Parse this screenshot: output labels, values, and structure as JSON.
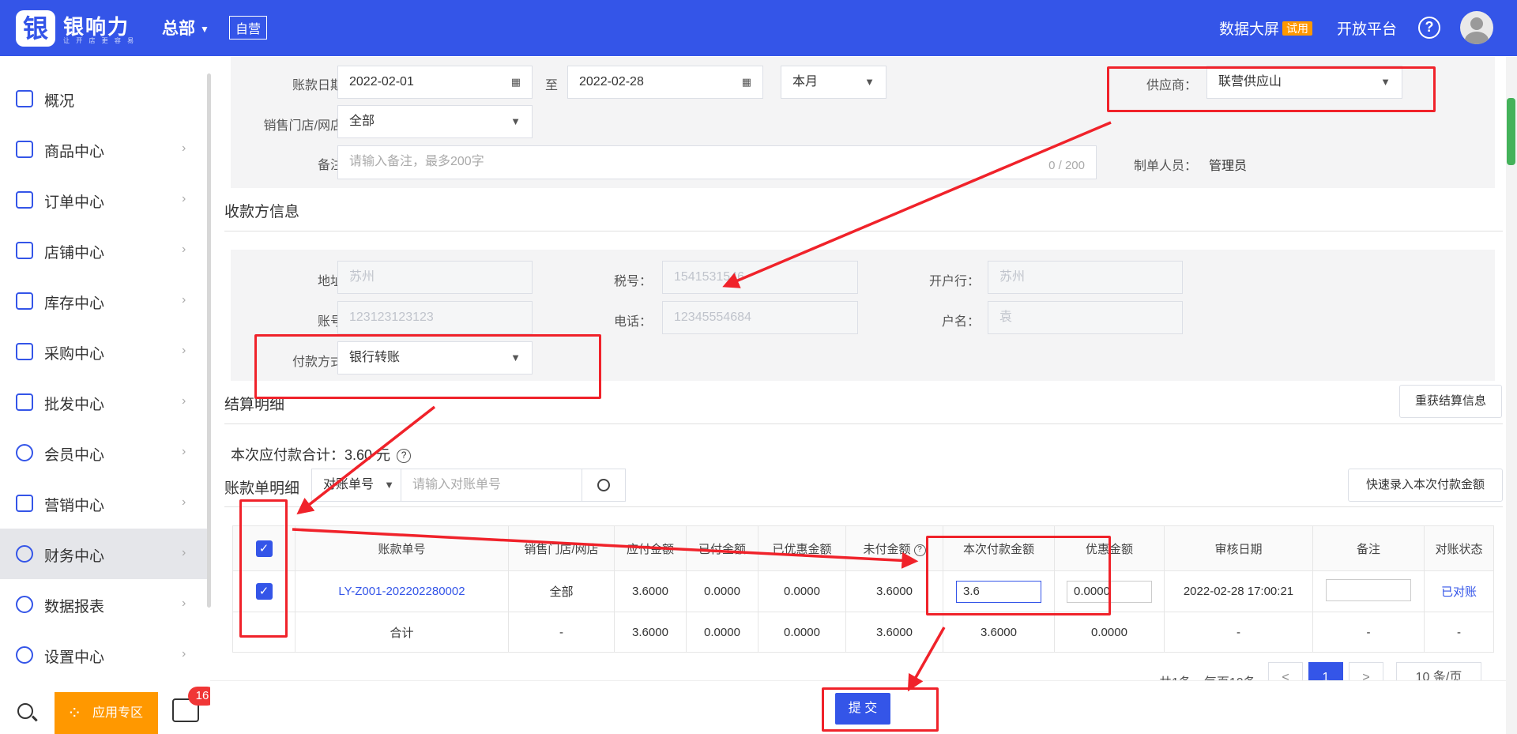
{
  "header": {
    "brand": "银响力",
    "brand_sub": "让 开 店 更 容 易",
    "hq": "总部",
    "self_tag": "自营",
    "data_screen": "数据大屏",
    "trial": "试用",
    "open_platform": "开放平台",
    "help": "?"
  },
  "sidebar": {
    "items": [
      {
        "label": "概况"
      },
      {
        "label": "商品中心"
      },
      {
        "label": "订单中心"
      },
      {
        "label": "店铺中心"
      },
      {
        "label": "库存中心"
      },
      {
        "label": "采购中心"
      },
      {
        "label": "批发中心"
      },
      {
        "label": "会员中心"
      },
      {
        "label": "营销中心"
      },
      {
        "label": "财务中心"
      },
      {
        "label": "数据报表"
      },
      {
        "label": "设置中心"
      }
    ],
    "app_zone": "应用专区",
    "msg_count": "16"
  },
  "form": {
    "date_label": "账款日期：",
    "date_start": "2022-02-01",
    "to": "至",
    "date_end": "2022-02-28",
    "period": "本月",
    "supplier_label": "供应商：",
    "supplier": "联营供应山",
    "store_label": "销售门店/网店：",
    "store": "全部",
    "remark_label": "备注：",
    "remark_placeholder": "请输入备注，最多200字",
    "remark_count": "0 / 200",
    "creator_label": "制单人员：",
    "creator": "管理员"
  },
  "payee": {
    "title": "收款方信息",
    "address_label": "地址：",
    "address": "苏州",
    "tax_label": "税号：",
    "tax": "1541531546",
    "bank_label": "开户行：",
    "bank": "苏州",
    "account_label": "账号：",
    "account": "123123123123",
    "phone_label": "电话：",
    "phone": "12345554684",
    "name_label": "户名：",
    "name": "袁",
    "pay_method_label": "付款方式：",
    "pay_method": "银行转账"
  },
  "settlement": {
    "title": "结算明细",
    "refresh_btn": "重获结算信息",
    "total_label": "本次应付款合计：",
    "total_value": "3.60 元"
  },
  "bill": {
    "title": "账款单明细",
    "search_type": "对账单号",
    "search_placeholder": "请输入对账单号",
    "quick_btn": "快速录入本次付款金额",
    "columns": [
      "账款单号",
      "销售门店/网店",
      "应付金额",
      "已付金额",
      "已优惠金额",
      "未付金额",
      "本次付款金额",
      "优惠金额",
      "审核日期",
      "备注",
      "对账状态"
    ],
    "row": {
      "no": "LY-Z001-202202280002",
      "store": "全部",
      "payable": "3.6000",
      "paid": "0.0000",
      "discounted": "0.0000",
      "unpaid": "3.6000",
      "pay_now": "3.6",
      "discount": "0.0000",
      "audit_date": "2022-02-28 17:00:21",
      "remark": "",
      "status": "已对账"
    },
    "total": {
      "label": "合计",
      "store": "-",
      "payable": "3.6000",
      "paid": "0.0000",
      "discounted": "0.0000",
      "unpaid": "3.6000",
      "pay_now": "3.6000",
      "discount": "0.0000",
      "audit_date": "-",
      "remark": "-",
      "status": "-"
    }
  },
  "pagination": {
    "summary": "共1条，每页10条",
    "prev": "<",
    "page": "1",
    "next": ">",
    "size": "10 条/页"
  },
  "submit": "提 交",
  "colors": {
    "primary": "#3455e8",
    "annotation": "#f0222a",
    "accent": "#ff9800"
  }
}
